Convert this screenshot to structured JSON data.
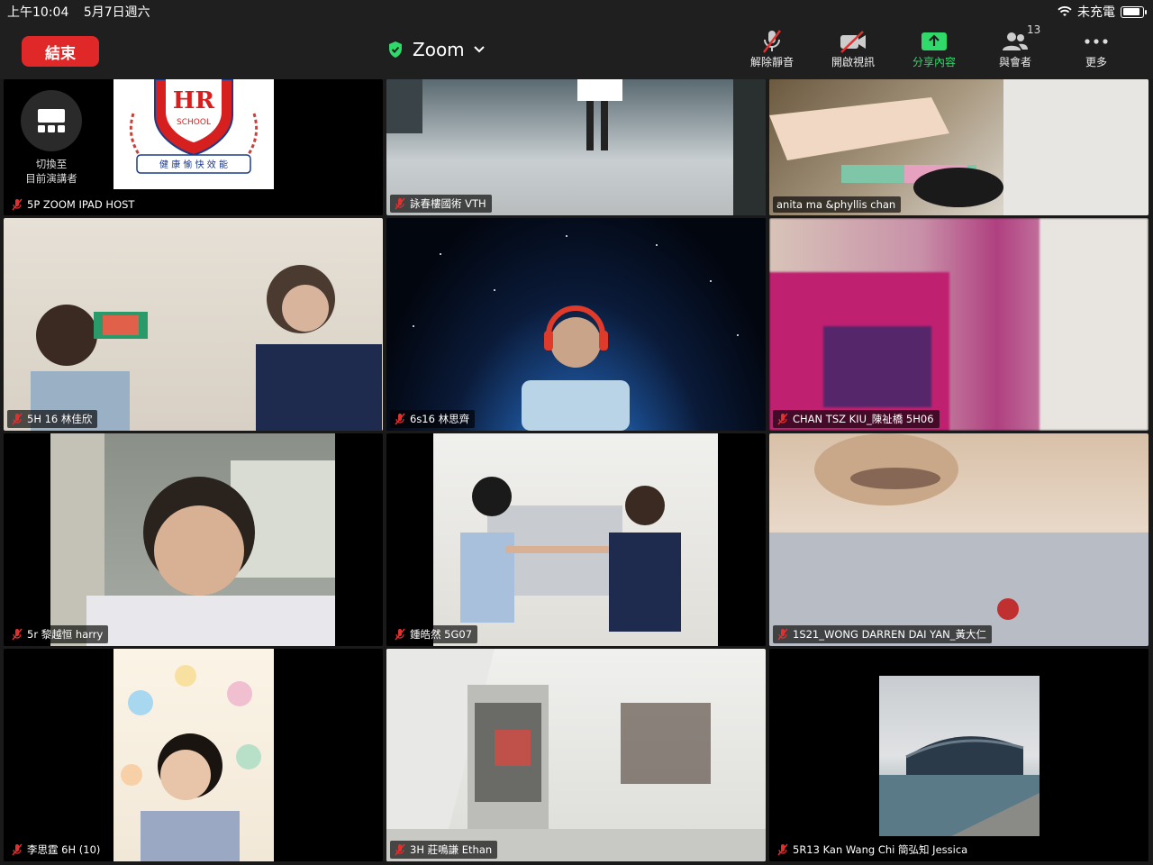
{
  "status_bar": {
    "time": "上午10:04",
    "date": "5月7日週六",
    "charging": "未充電"
  },
  "toolbar": {
    "end_label": "結束",
    "meeting_title": "Zoom",
    "tools": {
      "unmute": "解除靜音",
      "start_video": "開啟視訊",
      "share": "分享內容",
      "participants": "與會者",
      "participants_count": "13",
      "more": "更多"
    }
  },
  "presenter_switch": {
    "line1": "切換至",
    "line2": "目前演講者"
  },
  "logo": {
    "text": "HR",
    "sub": "SCHOOL",
    "motto": "健 康 愉 快 效 能"
  },
  "tiles": [
    {
      "name": "5P ZOOM IPAD HOST"
    },
    {
      "name": "詠春樓國術 VTH"
    },
    {
      "name": "anita ma &phyllis chan"
    },
    {
      "name": "5H 16 林佳欣"
    },
    {
      "name": "6s16 林思齊"
    },
    {
      "name": "CHAN TSZ KIU_陳祉橋 5H06"
    },
    {
      "name": "5r 黎越恒 harry"
    },
    {
      "name": "鍾皓然 5G07"
    },
    {
      "name": "1S21_WONG DARREN DAI YAN_黃大仁"
    },
    {
      "name": "李思霆 6H (10)"
    },
    {
      "name": "3H 莊鳴謙 Ethan"
    },
    {
      "name": "5R13 Kan Wang Chi 簡弘知 Jessica"
    }
  ],
  "colors": {
    "end_button": "#e02828",
    "share_green": "#2fd96a",
    "active_speaker": "#34c84a",
    "mute_red": "#e03030"
  }
}
